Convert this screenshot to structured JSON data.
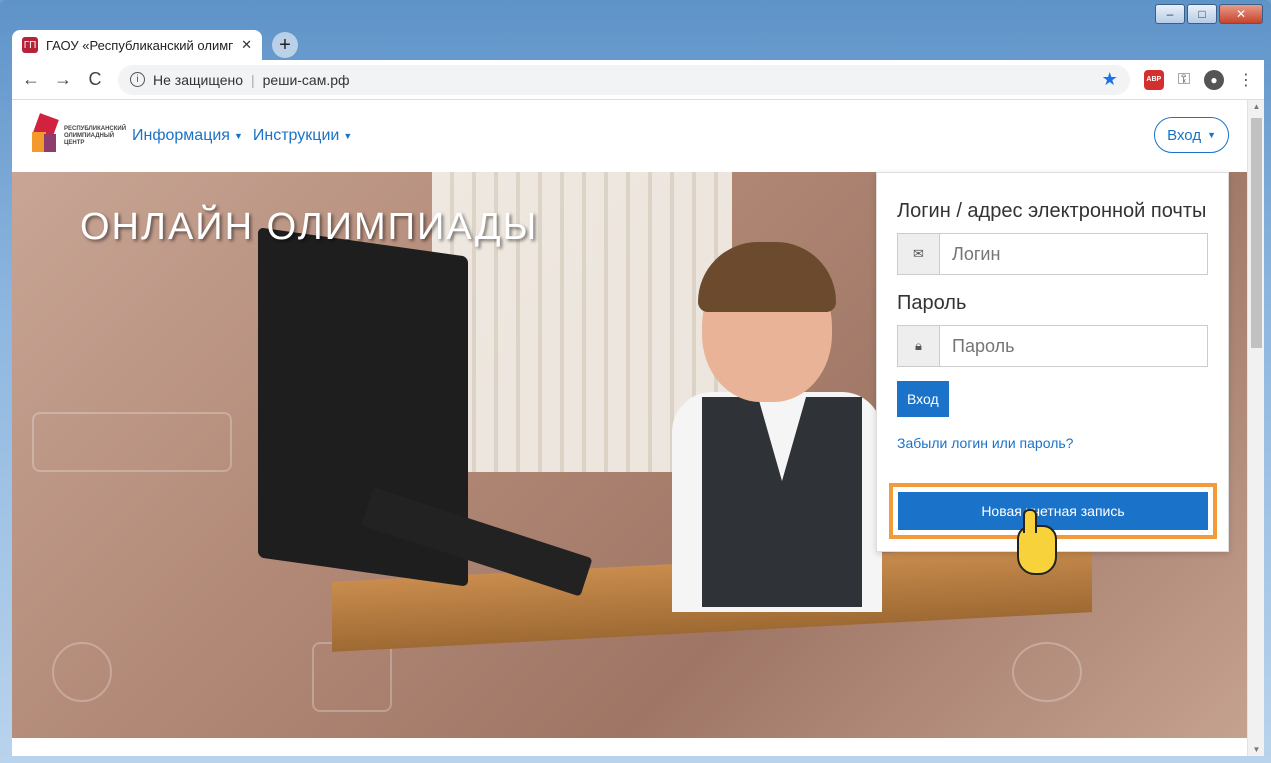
{
  "browser": {
    "tab_title": "ГАОУ «Республиканский олимп",
    "tab_favicon": "ГП",
    "new_tab_label": "+",
    "omnibox": {
      "security_label": "Не защищено",
      "url": "реши-сам.рф"
    },
    "extension_abp": "ABP",
    "window_controls": [
      "minimize",
      "maximize",
      "close"
    ]
  },
  "site": {
    "logo_text": "РЕСПУБЛИКАНСКИЙ ОЛИМПИАДНЫЙ ЦЕНТР",
    "nav": [
      {
        "label": "Информация"
      },
      {
        "label": "Инструкции"
      }
    ],
    "login_button": "Вход",
    "hero_title": "ОНЛАЙН ОЛИМПИАДЫ"
  },
  "login": {
    "login_label": "Логин / адрес электронной почты",
    "login_placeholder": "Логин",
    "password_label": "Пароль",
    "password_placeholder": "Пароль",
    "submit_label": "Вход",
    "forgot_link": "Забыли логин или пароль?",
    "new_account_label": "Новая учетная запись"
  },
  "colors": {
    "accent": "#1a73c8",
    "highlight": "#f39a3a"
  }
}
